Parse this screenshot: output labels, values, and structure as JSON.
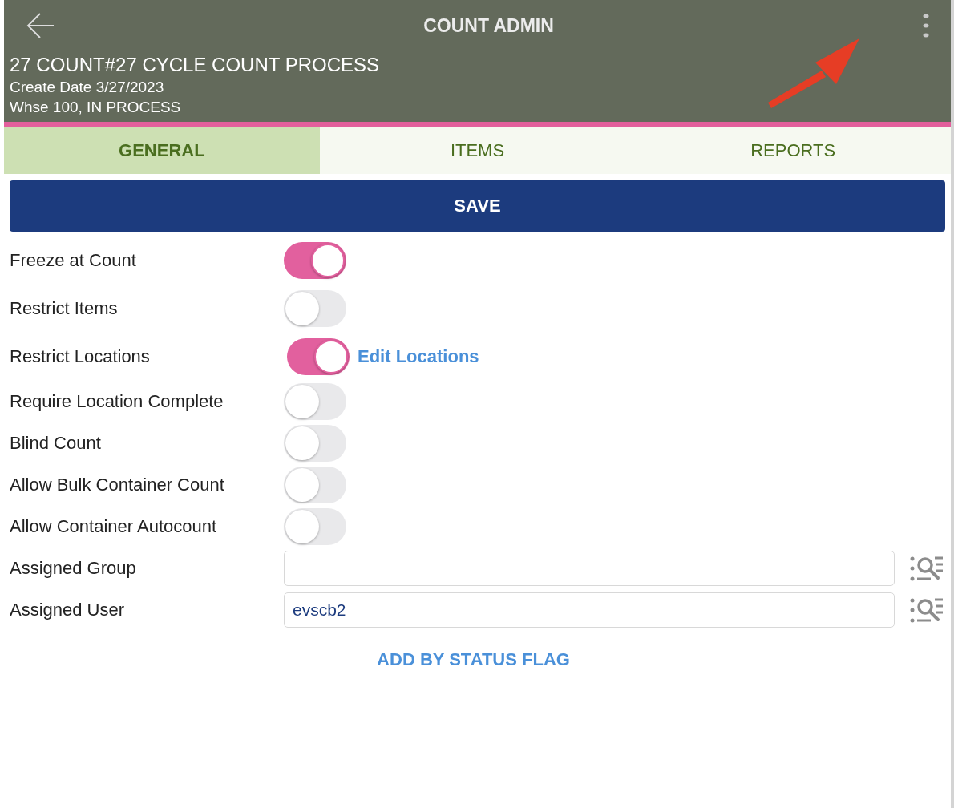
{
  "header": {
    "title": "COUNT ADMIN",
    "record_title": "27 COUNT#27 CYCLE COUNT PROCESS",
    "create_date": "Create Date 3/27/2023",
    "status": "Whse 100, IN PROCESS"
  },
  "tabs": [
    {
      "label": "GENERAL",
      "selected": true
    },
    {
      "label": "ITEMS",
      "selected": false
    },
    {
      "label": "REPORTS",
      "selected": false
    }
  ],
  "save_button": "SAVE",
  "settings": [
    {
      "kind": "toggle",
      "label": "Freeze at Count",
      "on": true
    },
    {
      "kind": "toggle",
      "label": "Restrict Items",
      "on": false
    },
    {
      "kind": "toggle",
      "label": "Restrict Locations",
      "on": true,
      "link": "Edit Locations"
    },
    {
      "kind": "toggle",
      "label": "Require Location Complete",
      "on": false
    },
    {
      "kind": "toggle",
      "label": "Blind Count",
      "on": false
    },
    {
      "kind": "toggle",
      "label": "Allow Bulk Container Count",
      "on": false
    },
    {
      "kind": "toggle",
      "label": "Allow Container Autocount",
      "on": false
    },
    {
      "kind": "lookup",
      "label": "Assigned Group"
    },
    {
      "kind": "lookup",
      "label": "Assigned User",
      "value": "evscb2"
    }
  ],
  "add_by_status_flag": "ADD BY STATUS FLAG"
}
